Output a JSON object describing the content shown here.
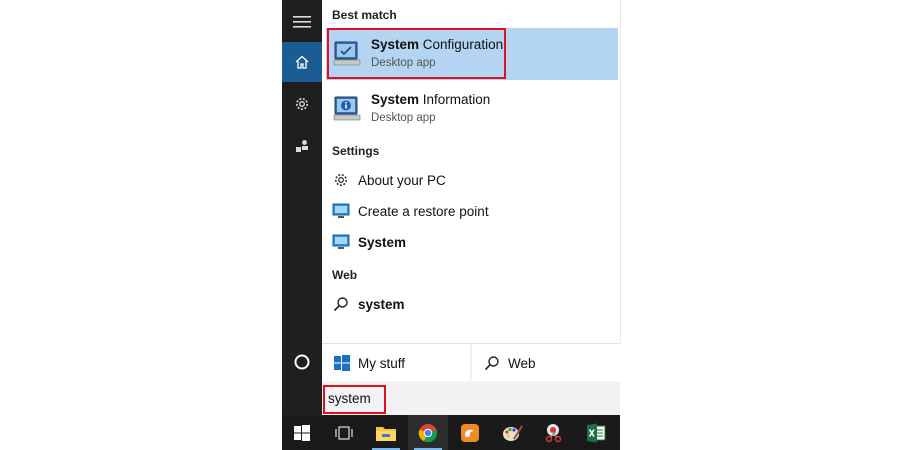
{
  "results": {
    "best_match_header": "Best match",
    "best_match": [
      {
        "title_bold": "System",
        "title_rest": " Configuration",
        "subtitle": "Desktop app",
        "selected": true
      },
      {
        "title_bold": "System",
        "title_rest": " Information",
        "subtitle": "Desktop app",
        "selected": false
      }
    ],
    "settings_header": "Settings",
    "settings": [
      {
        "label_pre": "About your PC",
        "label_bold": "",
        "icon": "gear-icon"
      },
      {
        "label_pre": "Create a restore point",
        "label_bold": "",
        "icon": "monitor-icon"
      },
      {
        "label_pre": "",
        "label_bold": "System",
        "icon": "monitor-icon"
      }
    ],
    "web_header": "Web",
    "web": [
      {
        "label_bold": "system",
        "icon": "search-icon"
      }
    ]
  },
  "filters": {
    "my_stuff": "My stuff",
    "web": "Web"
  },
  "search": {
    "value": "system"
  },
  "colors": {
    "rail_bg": "#1f1f1f",
    "rail_active": "#1b5c95",
    "selection": "#b3d5f2",
    "highlight_box": "#e01020",
    "taskbar_bg": "#1a1a1a",
    "accent": "#76b9ed"
  }
}
